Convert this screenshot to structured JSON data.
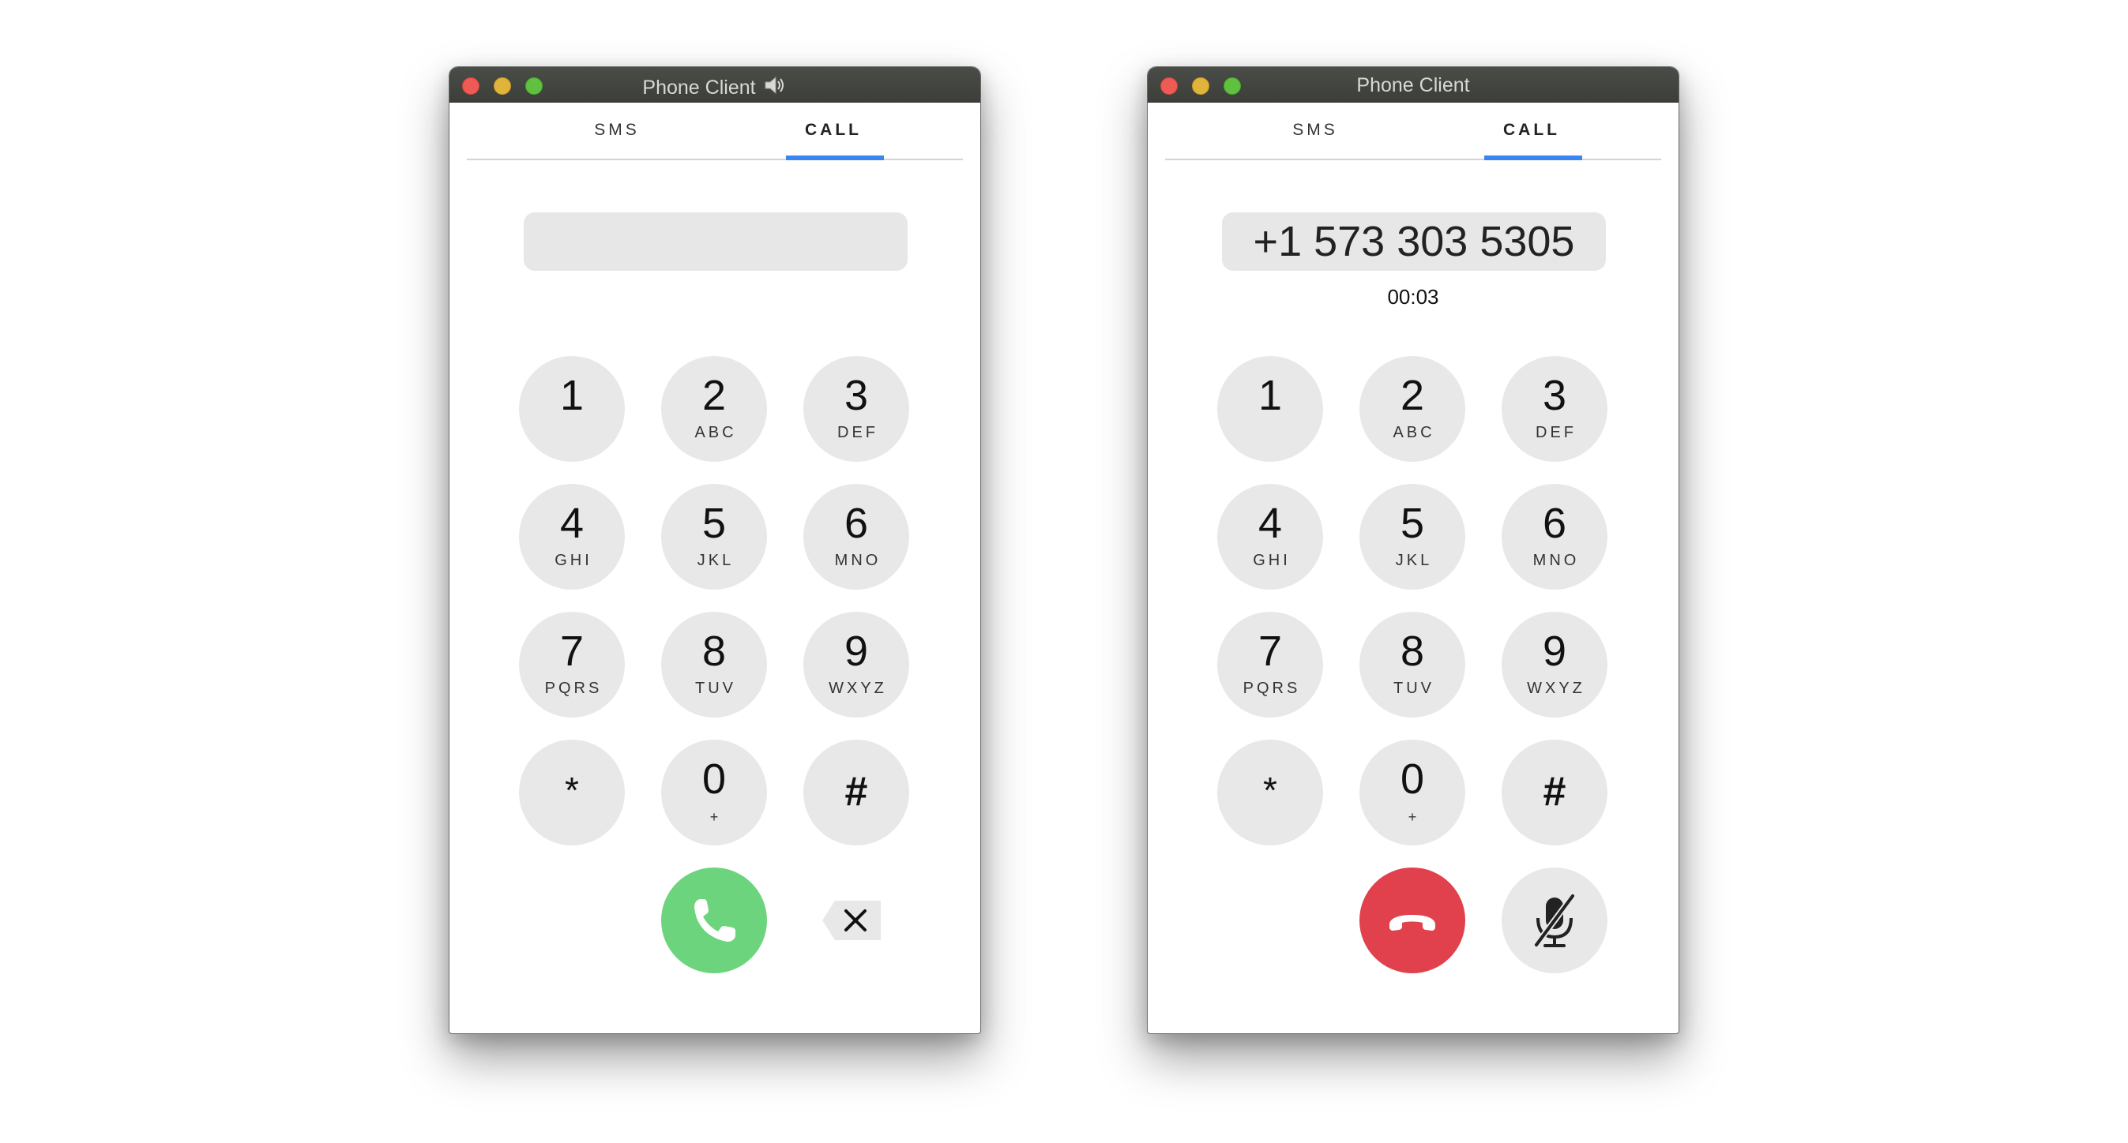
{
  "windows": [
    {
      "title": "Phone Client",
      "tabs": [
        {
          "label": "SMS"
        },
        {
          "label": "CALL"
        }
      ],
      "number": "",
      "timer": ""
    },
    {
      "title": "Phone Client",
      "tabs": [
        {
          "label": "SMS"
        },
        {
          "label": "CALL"
        }
      ],
      "number": "+1 573 303 5305",
      "timer": "00:03"
    }
  ],
  "keypad": [
    {
      "digit": "1",
      "letters": ""
    },
    {
      "digit": "2",
      "letters": "ABC"
    },
    {
      "digit": "3",
      "letters": "DEF"
    },
    {
      "digit": "4",
      "letters": "GHI"
    },
    {
      "digit": "5",
      "letters": "JKL"
    },
    {
      "digit": "6",
      "letters": "MNO"
    },
    {
      "digit": "7",
      "letters": "PQRS"
    },
    {
      "digit": "8",
      "letters": "TUV"
    },
    {
      "digit": "9",
      "letters": "WXYZ"
    },
    {
      "digit": "*",
      "letters": ""
    },
    {
      "digit": "0",
      "letters": "+"
    },
    {
      "digit": "#",
      "letters": ""
    }
  ],
  "icons": {
    "speaker": "speaker-icon",
    "call": "phone-icon",
    "hangup": "hang-up-icon",
    "mute": "microphone-muted-icon",
    "backspace": "backspace-icon"
  },
  "colors": {
    "tab_indicator": "#3a86f0",
    "call_button": "#6dd47e",
    "hangup_button": "#e0414c",
    "key_background": "#e8e8e8"
  }
}
